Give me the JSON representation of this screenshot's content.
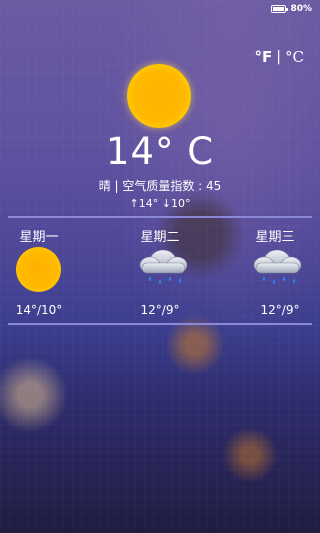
{
  "status_bar": {
    "battery": "80%",
    "battery_level": 0.8
  },
  "units": {
    "fahrenheit": "°F",
    "separator": "|",
    "celsius": "°C"
  },
  "current": {
    "icon": "sun-icon",
    "temperature": "14° C",
    "summary": "晴  |  空气质量指数 : 45",
    "high_low": "↑14° ↓10°"
  },
  "forecast": [
    {
      "day": "星期一",
      "icon": "sun-icon",
      "range": "14°/10°"
    },
    {
      "day": "星期二",
      "icon": "rain-cloud-icon",
      "range": "12°/9°"
    },
    {
      "day": "星期三",
      "icon": "rain-cloud-icon",
      "range": "12°/9°"
    }
  ],
  "colors": {
    "sun": "#ffb300",
    "divider": "#8c88d8",
    "rain_drop": "#1e8fff"
  }
}
